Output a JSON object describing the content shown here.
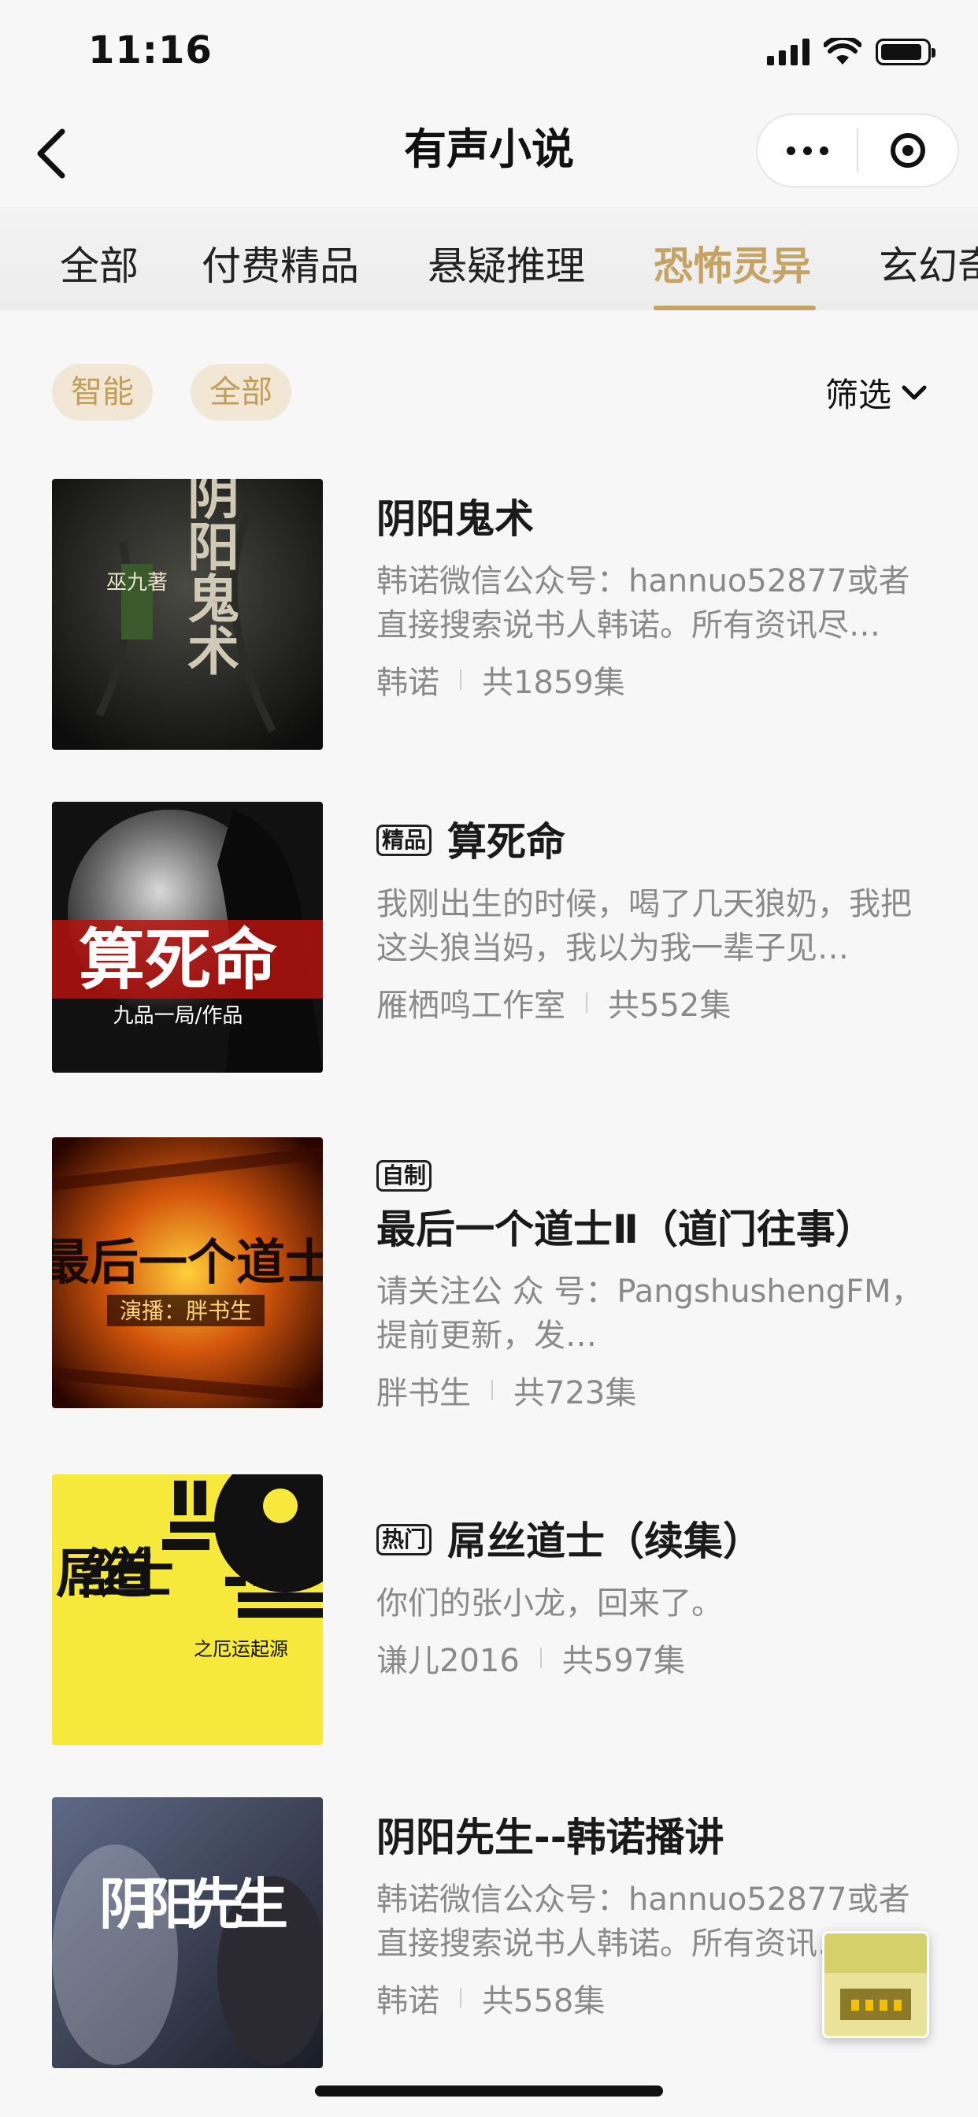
{
  "status_bar": {
    "time": "11:16"
  },
  "nav": {
    "title": "有声小说"
  },
  "tabs": [
    {
      "label": "全部"
    },
    {
      "label": "付费精品"
    },
    {
      "label": "悬疑推理"
    },
    {
      "label": "恐怖灵异"
    },
    {
      "label": "玄幻奇"
    }
  ],
  "active_tab": "恐怖灵异",
  "filters": {
    "chips": [
      "智能",
      "全部"
    ],
    "filter_label": "筛选"
  },
  "colors": {
    "accent": "#c4a365",
    "chip_bg": "#f1e7d4"
  },
  "books": [
    {
      "title": "阴阳鬼术",
      "tag": "",
      "description": "韩诺微信公众号：hannuo52877或者直接搜索说书人韩诺。所有资讯尽…",
      "author": "韩诺",
      "episodes": "共1859集",
      "cover_text": "阴阳鬼术",
      "cover_subtext": "巫九著"
    },
    {
      "title": "算死命",
      "tag": "精品",
      "description": "我刚出生的时候，喝了几天狼奶，我把这头狼当妈，我以为我一辈子见…",
      "author": "雁栖鸣工作室",
      "episodes": "共552集",
      "cover_text": "算死命",
      "cover_subtext": "九品一局/作品"
    },
    {
      "title": "最后一个道士Ⅱ（道门往事）",
      "tag": "自制",
      "description": "请关注公 众 号：PangshushengFM，提前更新，发…",
      "author": "胖书生",
      "episodes": "共723集",
      "cover_text": "最后一个道士",
      "cover_subtext": "演播：胖书生"
    },
    {
      "title": "屌丝道士（续集）",
      "tag": "热门",
      "description": "你们的张小龙，回来了。",
      "author": "谦儿2016",
      "episodes": "共597集",
      "cover_text": "屌丝道士",
      "cover_subtext": "之厄运起源"
    },
    {
      "title": "阴阳先生--韩诺播讲",
      "tag": "",
      "description": "韩诺微信公众号：hannuo52877或者直接搜索说书人韩诺。所有资讯…",
      "author": "韩诺",
      "episodes": "共558集",
      "cover_text": "阴阳先生",
      "cover_subtext": ""
    }
  ]
}
